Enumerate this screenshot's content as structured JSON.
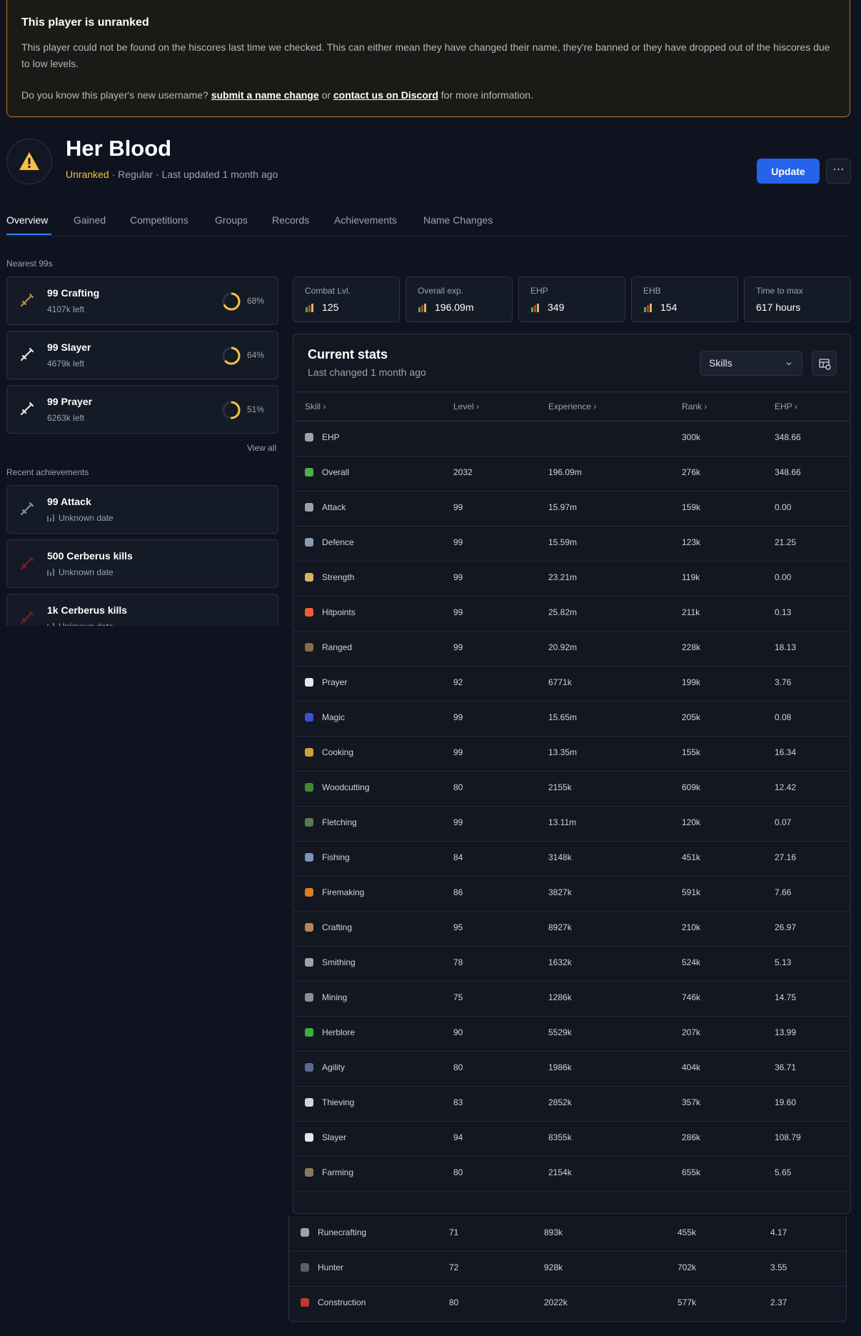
{
  "banner": {
    "title": "This player is unranked",
    "body": "This player could not be found on the hiscores last time we checked. This can either mean they have changed their name, they're banned or they have dropped out of the hiscores due to low levels.",
    "question": "Do you know this player's new username?",
    "link1": "submit a name change",
    "or": "or",
    "link2": "contact us on Discord",
    "tail": "for more information."
  },
  "player": {
    "name": "Her Blood",
    "status": "Unranked",
    "meta": "· Regular · Last updated 1 month ago"
  },
  "actions": {
    "update": "Update",
    "more": "⋯"
  },
  "tabs": [
    "Overview",
    "Gained",
    "Competitions",
    "Groups",
    "Records",
    "Achievements",
    "Name Changes"
  ],
  "nearest": {
    "label": "Nearest 99s",
    "items": [
      {
        "title": "99 Crafting",
        "sub": "4107k left",
        "pct": "68%",
        "frac": 0.68,
        "icon": "crafting-icon",
        "color": "#c08a4a"
      },
      {
        "title": "99 Slayer",
        "sub": "4679k left",
        "pct": "64%",
        "frac": 0.64,
        "icon": "slayer-icon",
        "color": "#e5e7eb"
      },
      {
        "title": "99 Prayer",
        "sub": "6263k left",
        "pct": "51%",
        "frac": 0.51,
        "icon": "prayer-icon",
        "color": "#e5e7eb"
      }
    ],
    "view_all": "View all"
  },
  "achievements": {
    "label": "Recent achievements",
    "items": [
      {
        "title": "99 Attack",
        "sub": "Unknown date",
        "icon": "attack-icon"
      },
      {
        "title": "500 Cerberus kills",
        "sub": "Unknown date",
        "icon": "cerberus-icon"
      },
      {
        "title": "1k Cerberus kills",
        "sub": "Unknown date",
        "icon": "cerberus-icon"
      }
    ]
  },
  "stats": [
    {
      "label": "Combat Lvl.",
      "value": "125",
      "icon": "combat-icon"
    },
    {
      "label": "Overall exp.",
      "value": "196.09m",
      "icon": "overall-icon"
    },
    {
      "label": "EHP",
      "value": "349",
      "icon": "ehp-icon"
    },
    {
      "label": "EHB",
      "value": "154",
      "icon": "ehb-icon"
    },
    {
      "label": "Time to max",
      "value": "617 hours",
      "icon": ""
    }
  ],
  "current": {
    "title": "Current stats",
    "sub": "Last changed 1 month ago",
    "select": "Skills",
    "headers": [
      "Skill",
      "Level",
      "Experience",
      "Rank",
      "EHP"
    ]
  },
  "skills": [
    {
      "name": "EHP",
      "level": "",
      "exp": "",
      "rank": "300k",
      "ehp": "348.66",
      "color": "#a3a3a3"
    },
    {
      "name": "Overall",
      "level": "2032",
      "exp": "196.09m",
      "rank": "276k",
      "ehp": "348.66",
      "color": "#4caf50"
    },
    {
      "name": "Attack",
      "level": "99",
      "exp": "15.97m",
      "rank": "159k",
      "ehp": "0.00",
      "color": "#9ca3af"
    },
    {
      "name": "Defence",
      "level": "99",
      "exp": "15.59m",
      "rank": "123k",
      "ehp": "21.25",
      "color": "#8b9bb4"
    },
    {
      "name": "Strength",
      "level": "99",
      "exp": "23.21m",
      "rank": "119k",
      "ehp": "0.00",
      "color": "#d9b26a"
    },
    {
      "name": "Hitpoints",
      "level": "99",
      "exp": "25.82m",
      "rank": "211k",
      "ehp": "0.13",
      "color": "#ef5b3c"
    },
    {
      "name": "Ranged",
      "level": "99",
      "exp": "20.92m",
      "rank": "228k",
      "ehp": "18.13",
      "color": "#8a6b45"
    },
    {
      "name": "Prayer",
      "level": "92",
      "exp": "6771k",
      "rank": "199k",
      "ehp": "3.76",
      "color": "#e5e7eb"
    },
    {
      "name": "Magic",
      "level": "99",
      "exp": "15.65m",
      "rank": "205k",
      "ehp": "0.08",
      "color": "#3b4fd1"
    },
    {
      "name": "Cooking",
      "level": "99",
      "exp": "13.35m",
      "rank": "155k",
      "ehp": "16.34",
      "color": "#c8a23a"
    },
    {
      "name": "Woodcutting",
      "level": "80",
      "exp": "2155k",
      "rank": "609k",
      "ehp": "12.42",
      "color": "#3f8a2e"
    },
    {
      "name": "Fletching",
      "level": "99",
      "exp": "13.11m",
      "rank": "120k",
      "ehp": "0.07",
      "color": "#5b7a52"
    },
    {
      "name": "Fishing",
      "level": "84",
      "exp": "3148k",
      "rank": "451k",
      "ehp": "27.16",
      "color": "#7c93b4"
    },
    {
      "name": "Firemaking",
      "level": "86",
      "exp": "3827k",
      "rank": "591k",
      "ehp": "7.66",
      "color": "#e07b24"
    },
    {
      "name": "Crafting",
      "level": "95",
      "exp": "8927k",
      "rank": "210k",
      "ehp": "26.97",
      "color": "#b98550"
    },
    {
      "name": "Smithing",
      "level": "78",
      "exp": "1632k",
      "rank": "524k",
      "ehp": "5.13",
      "color": "#9ca3af"
    },
    {
      "name": "Mining",
      "level": "75",
      "exp": "1286k",
      "rank": "746k",
      "ehp": "14.75",
      "color": "#8a8f99"
    },
    {
      "name": "Herblore",
      "level": "90",
      "exp": "5529k",
      "rank": "207k",
      "ehp": "13.99",
      "color": "#3fae3f"
    },
    {
      "name": "Agility",
      "level": "80",
      "exp": "1986k",
      "rank": "404k",
      "ehp": "36.71",
      "color": "#5a6a8a"
    },
    {
      "name": "Thieving",
      "level": "83",
      "exp": "2852k",
      "rank": "357k",
      "ehp": "19.60",
      "color": "#d1d5db"
    },
    {
      "name": "Slayer",
      "level": "94",
      "exp": "8355k",
      "rank": "286k",
      "ehp": "108.79",
      "color": "#e5e7eb"
    },
    {
      "name": "Farming",
      "level": "80",
      "exp": "2154k",
      "rank": "655k",
      "ehp": "5.65",
      "color": "#8a7a5a"
    }
  ],
  "skills_more": [
    {
      "name": "Runecrafting",
      "level": "71",
      "exp": "893k",
      "rank": "455k",
      "ehp": "4.17",
      "color": "#9ca3af"
    },
    {
      "name": "Hunter",
      "level": "72",
      "exp": "928k",
      "rank": "702k",
      "ehp": "3.55",
      "color": "#5a5f6a"
    },
    {
      "name": "Construction",
      "level": "80",
      "exp": "2022k",
      "rank": "577k",
      "ehp": "2.37",
      "color": "#c0392b"
    }
  ]
}
